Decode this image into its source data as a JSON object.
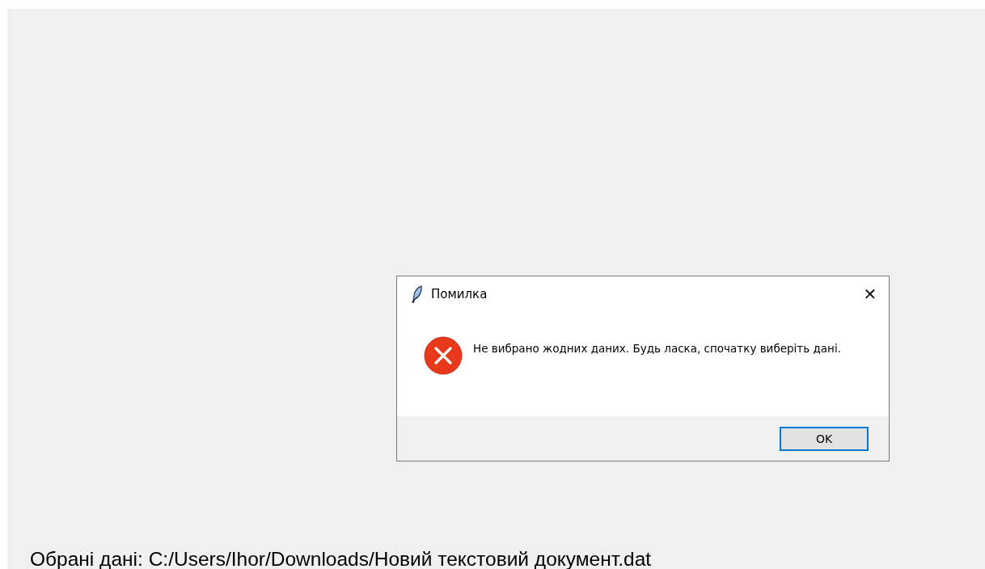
{
  "main_window": {
    "selected_data_label": "Обрані дані: C:/Users/Ihor/Downloads/Новий текстовий документ.dat"
  },
  "dialog": {
    "title": "Помилка",
    "close": "✕",
    "kind": "error",
    "message": "Не вибрано жодних даних. Будь ласка, спочатку виберіть дані.",
    "buttons": [
      {
        "label": "OK",
        "focused": true
      }
    ]
  }
}
